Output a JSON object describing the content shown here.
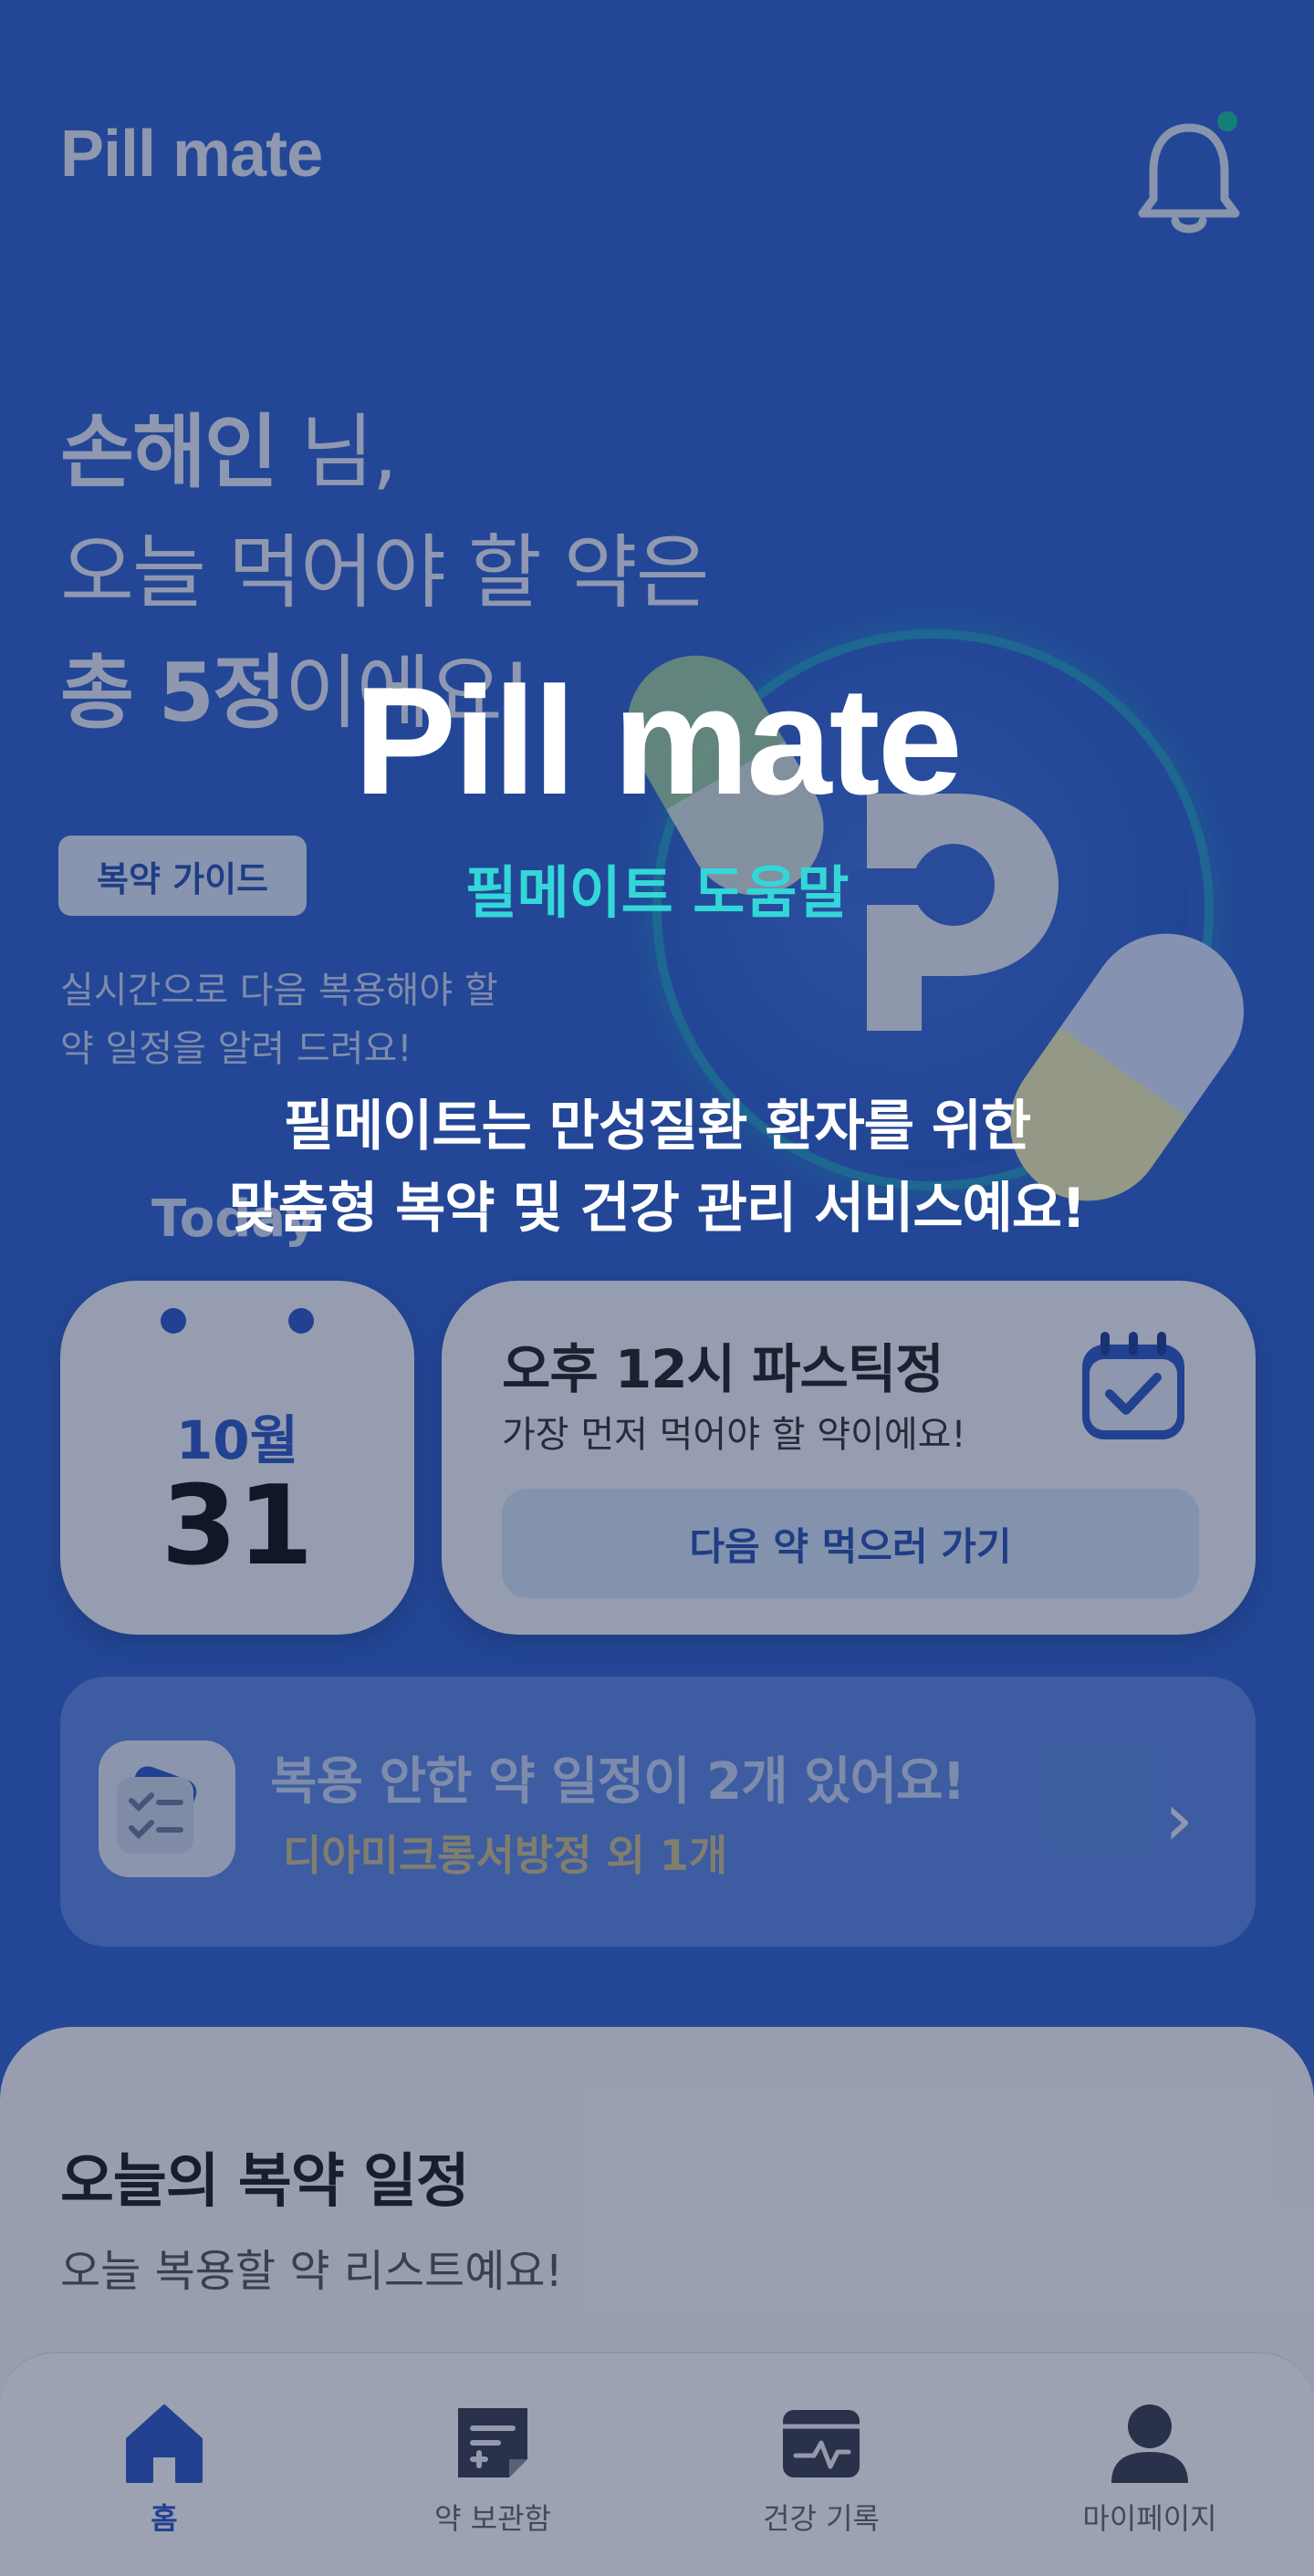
{
  "app": {
    "logo": "Pill mate"
  },
  "greeting": {
    "name": "손해인",
    "name_suffix": " 님,",
    "line2": "오늘 먹어야 할 약은",
    "count": "총 5정",
    "count_suffix": "이에요!"
  },
  "guide": {
    "button_label": "복약 가이드",
    "description_line1": "실시간으로 다음 복용해야 할",
    "description_line2": "약 일정을 알려 드려요!"
  },
  "today_label": "Today",
  "date_card": {
    "month": "10월",
    "day": "31"
  },
  "next_dose": {
    "title": "오후 12시 파스틱정",
    "subtitle": "가장 먼저 먹어야 할 약이에요!",
    "button_label": "다음 약 먹으러 가기"
  },
  "missed": {
    "title": "복용 안한 약 일정이 2개 있어요!",
    "subtitle": "디아미크롱서방정 외 1개"
  },
  "schedule": {
    "title": "오늘의 복약 일정",
    "subtitle": "오늘 복용할  약 리스트예요!"
  },
  "tabs": [
    {
      "label": "홈",
      "icon": "home-icon",
      "active": true
    },
    {
      "label": "약 보관함",
      "icon": "pill-box-icon",
      "active": false
    },
    {
      "label": "건강 기록",
      "icon": "health-record-icon",
      "active": false
    },
    {
      "label": "마이페이지",
      "icon": "user-icon",
      "active": false
    }
  ],
  "overlay": {
    "logo": "Pill mate",
    "subtitle": "필메이트 도움말",
    "description_line1": "필메이트는 만성질환 환자를 위한",
    "description_line2": "맞춤형 복약 및 건강 관리 서비스예요!"
  },
  "colors": {
    "primary_blue": "#2f62cf",
    "accent_teal": "#33d7d8",
    "notification_dot": "#17c49a"
  }
}
